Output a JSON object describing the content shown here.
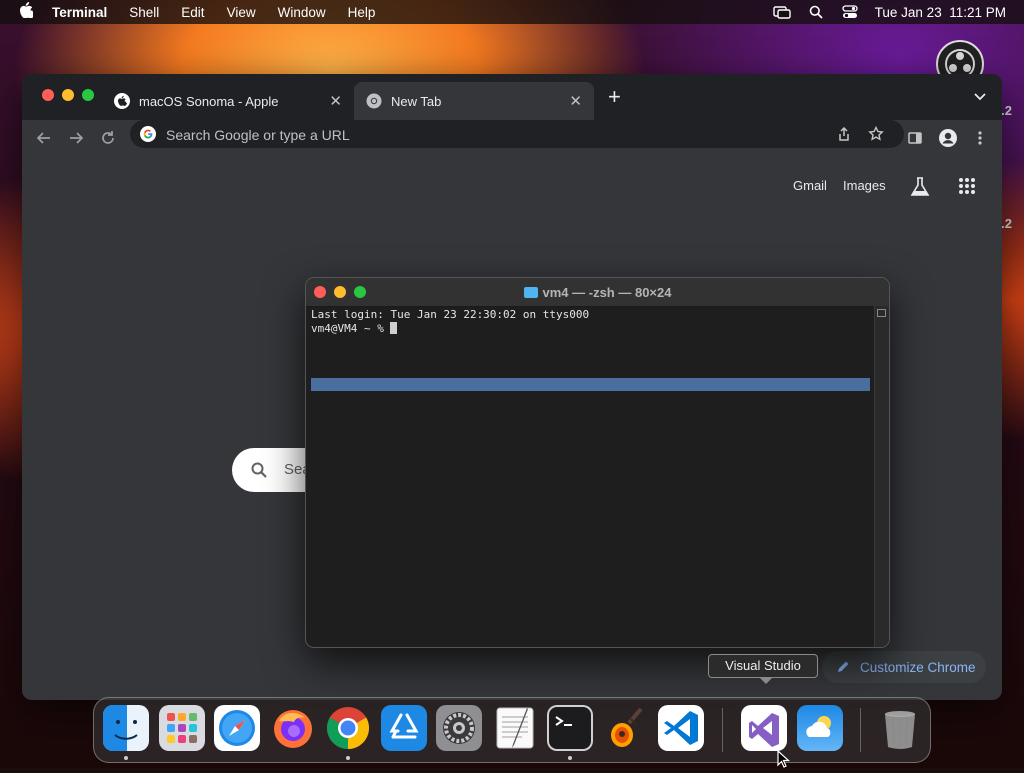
{
  "menubar": {
    "app": "Terminal",
    "items": [
      "Shell",
      "Edit",
      "View",
      "Window",
      "Help"
    ],
    "clock": "Tue Jan 23  11:21 PM"
  },
  "desktop": {
    "side_labels": [
      ".2",
      ".2"
    ]
  },
  "chrome": {
    "tabs": [
      {
        "title": "macOS Sonoma - Apple",
        "favicon": "apple-icon",
        "active": false
      },
      {
        "title": "New Tab",
        "favicon": "chrome-icon",
        "active": true
      }
    ],
    "omnibox": {
      "placeholder": "Search Google or type a URL"
    },
    "ntp": {
      "links": [
        "Gmail",
        "Images"
      ],
      "search_fragment": "Sea",
      "customize_label": "Customize Chrome"
    }
  },
  "terminal": {
    "title": "vm4 — -zsh — 80×24",
    "lines": [
      "Last login: Tue Jan 23 22:30:02 on ttys000",
      "vm4@VM4 ~ % "
    ]
  },
  "tooltip": {
    "text": "Visual Studio"
  },
  "dock": {
    "apps": [
      {
        "name": "Finder",
        "icon": "finder-icon",
        "running": true
      },
      {
        "name": "Launchpad",
        "icon": "launchpad-icon",
        "running": false
      },
      {
        "name": "Safari",
        "icon": "safari-icon",
        "running": false
      },
      {
        "name": "Firefox",
        "icon": "firefox-icon",
        "running": false
      },
      {
        "name": "Google Chrome",
        "icon": "chrome-icon",
        "running": true
      },
      {
        "name": "App Store",
        "icon": "app-store-icon",
        "running": false
      },
      {
        "name": "System Settings",
        "icon": "system-settings-icon",
        "running": false
      },
      {
        "name": "TextEdit",
        "icon": "textedit-icon",
        "running": false
      },
      {
        "name": "Terminal",
        "icon": "terminal-icon",
        "running": true
      },
      {
        "name": "GarageBand",
        "icon": "garageband-icon",
        "running": false
      },
      {
        "name": "Visual Studio Code",
        "icon": "vscode-icon",
        "running": false
      },
      {
        "name": "Visual Studio",
        "icon": "visual-studio-icon",
        "running": false
      },
      {
        "name": "Weather",
        "icon": "weather-icon",
        "running": false
      },
      {
        "name": "Trash",
        "icon": "trash-icon",
        "running": false
      }
    ]
  },
  "colors": {
    "chrome_bg": "#35363a",
    "tab_strip": "#202124",
    "terminal_bg": "#1e1e1e",
    "selection": "#4a6f9e",
    "link_blue": "#8ab4f8"
  }
}
